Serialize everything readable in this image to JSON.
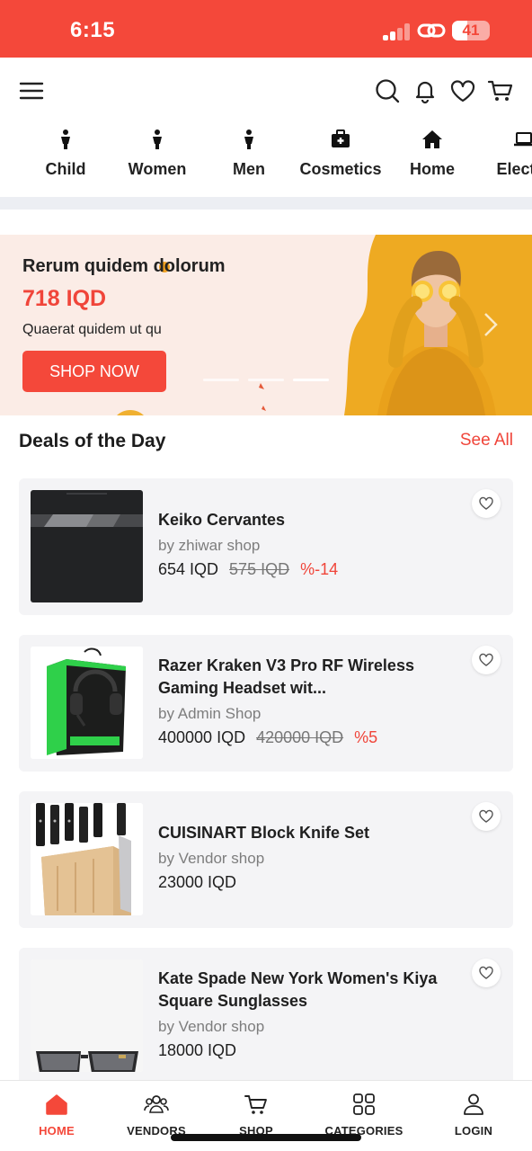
{
  "status_bar": {
    "time": "6:15",
    "battery_level": "41",
    "background_color": "#f4483a"
  },
  "header": {
    "menu_icon": "hamburger-menu-icon",
    "actions": [
      "search-icon",
      "bell-icon",
      "heart-icon",
      "cart-icon"
    ]
  },
  "categories": [
    {
      "label": "Child",
      "icon": "person-icon"
    },
    {
      "label": "Women",
      "icon": "person-icon"
    },
    {
      "label": "Men",
      "icon": "person-icon"
    },
    {
      "label": "Cosmetics",
      "icon": "first-aid-kit-icon"
    },
    {
      "label": "Home",
      "icon": "house-icon"
    },
    {
      "label": "Electro",
      "icon": "laptop-icon"
    }
  ],
  "banner": {
    "title": "Rerum quidem dolorum",
    "price": "718 IQD",
    "subtitle": "Quaerat quidem ut qu",
    "button_label": "SHOP NOW",
    "accent_color": "#f0453a",
    "image_bg_color": "#eeaa22"
  },
  "deals": {
    "title": "Deals of the Day",
    "see_all": "See All",
    "products": [
      {
        "name": "Keiko Cervantes",
        "vendor": "by zhiwar shop",
        "price": "654 IQD",
        "old_price": "575 IQD",
        "discount": "%-14",
        "image": "black-sweater"
      },
      {
        "name": "Razer Kraken V3 Pro RF Wireless Gaming Headset wit...",
        "vendor": "by Admin Shop",
        "price": "400000 IQD",
        "old_price": "420000 IQD",
        "discount": "%5",
        "image": "headset-box"
      },
      {
        "name": "CUISINART Block Knife Set",
        "vendor": "by Vendor shop",
        "price": "23000 IQD",
        "old_price": "",
        "discount": "",
        "image": "knife-block"
      },
      {
        "name": "Kate Spade New York Women's Kiya Square Sunglasses",
        "vendor": "by Vendor shop",
        "price": "18000 IQD",
        "old_price": "",
        "discount": "",
        "image": "sunglasses"
      }
    ]
  },
  "bottom_nav": {
    "active": "HOME",
    "active_color": "#f4483a",
    "items": [
      {
        "label": "HOME",
        "icon": "home-icon"
      },
      {
        "label": "VENDORS",
        "icon": "vendors-icon"
      },
      {
        "label": "SHOP",
        "icon": "cart-icon"
      },
      {
        "label": "CATEGORIES",
        "icon": "categories-grid-icon"
      },
      {
        "label": "LOGIN",
        "icon": "user-icon"
      }
    ]
  }
}
